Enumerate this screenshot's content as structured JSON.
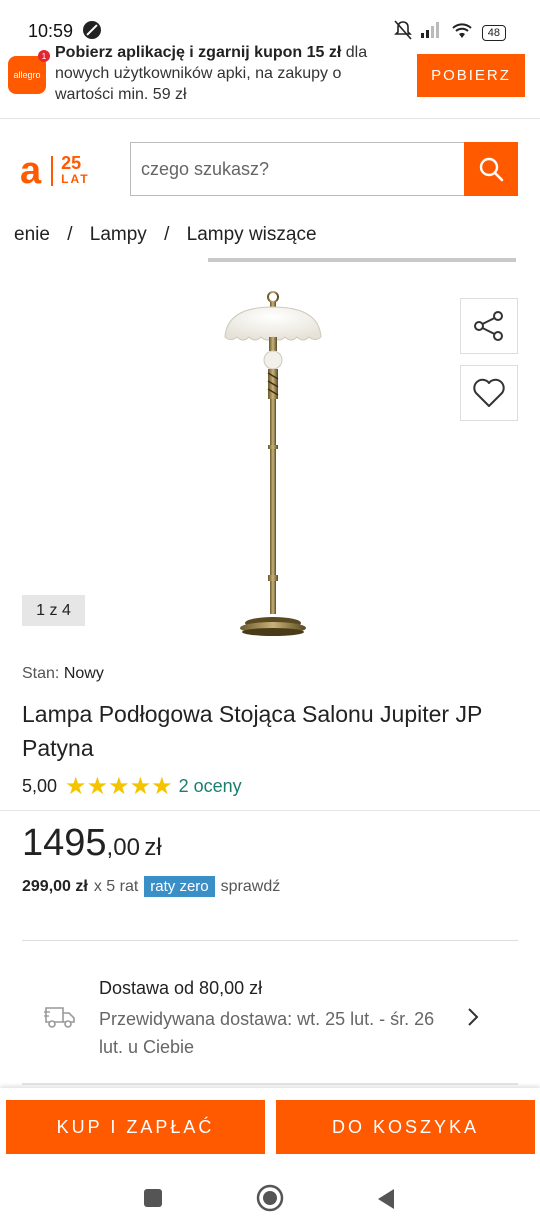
{
  "status": {
    "time": "10:59",
    "battery": "48"
  },
  "promo": {
    "app_icon_label": "allegro",
    "app_icon_badge": "1",
    "headline": "Pobierz aplikację i zgarnij kupon 15 zł",
    "line1_end": " dla",
    "line2": "nowych użytkowników apki, na zakupy o",
    "line3": "wartości min. 59 zł",
    "cta_label": "POBIERZ"
  },
  "header": {
    "logo_letter": "a",
    "logo_years": "25",
    "logo_lat": "LAT",
    "search_placeholder": "czego szukasz?"
  },
  "breadcrumb": {
    "items": [
      "enie",
      "Lampy",
      "Lampy wiszące"
    ],
    "separator": "/"
  },
  "gallery": {
    "counter": "1 z 4"
  },
  "product": {
    "condition_label": "Stan:",
    "condition_value": "Nowy",
    "title": "Lampa Podłogowa Stojąca Salonu Jupiter JP Patyna",
    "rating_value": "5,00",
    "rating_stars": 5,
    "rating_stars_glyphs": "★★★★★",
    "rating_count": "2 oceny"
  },
  "price": {
    "integer": "1495",
    "decimal": ",00",
    "currency": "zł",
    "installment_amount": "299,00 zł",
    "installment_count": "x 5 rat",
    "installment_tag": "raty zero",
    "installment_link": "sprawdź"
  },
  "delivery": {
    "line1": "Dostawa od 80,00 zł",
    "line2": "Przewidywana dostawa: wt. 25 lut. - śr. 26 lut. u Ciebie"
  },
  "actions": {
    "buy_now": "KUP I ZAPŁAĆ",
    "add_to_cart": "DO KOSZYKA"
  },
  "colors": {
    "brand": "#ff5a00",
    "rating": "#f5c400",
    "link": "#1a7f71",
    "tag": "#3b8fc7"
  }
}
